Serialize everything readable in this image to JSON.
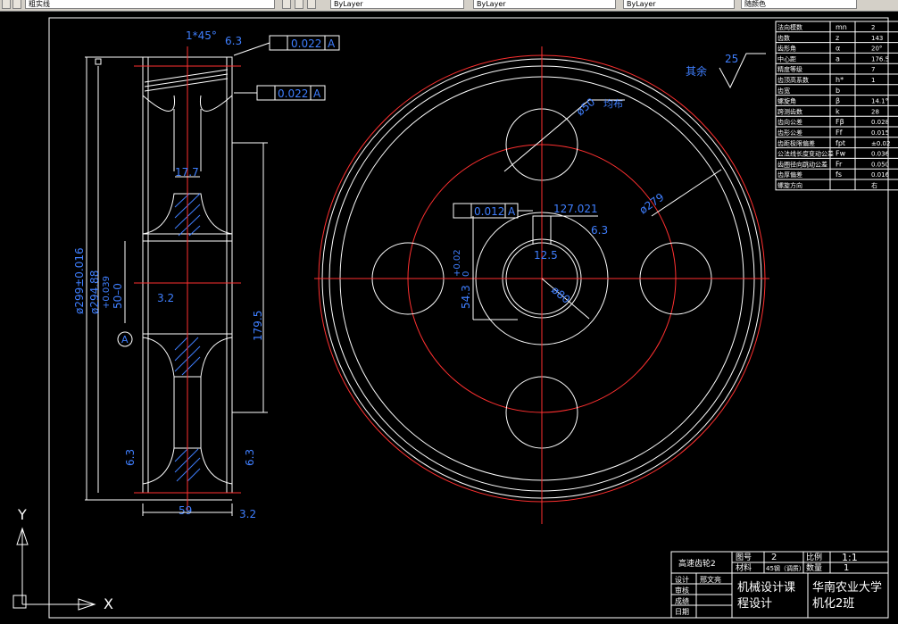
{
  "toolbar": {
    "layer_name": "粗实线",
    "color_combo": "ByLayer",
    "linetype_combo": "ByLayer",
    "lineweight_combo": "ByLayer",
    "plotstyle_combo": "随颜色"
  },
  "drawing": {
    "chamfer": "1*45°",
    "roughness_top": "6.3",
    "tol_runout_1": "0.022",
    "tol_runout_2": "0.022",
    "datum": "A",
    "dim_17_7": "17.7",
    "dim_dia_outer": "ø299±0.016",
    "dim_dia_root": "ø294.88",
    "dim_bore_tol": "+0.039",
    "dim_bore": "50–0",
    "roughness_3_2a": "3.2",
    "dim_179_5": "179.5",
    "roughness_6_3_left": "6.3",
    "roughness_6_3_right": "6.3",
    "dim_59": "59",
    "roughness_3_2b": "3.2",
    "hole_dia": "ø50",
    "hole_note": "均布",
    "dia_279": "ø279",
    "dia_80": "ø80",
    "sym_tol": "0.012",
    "keyway_depth": "127.021",
    "keyway_width": "12.5",
    "keyway_tol": "+0.02",
    "keyway_tol2": "0",
    "keyway_54": "54.3",
    "roughness_6_3_key": "6.3",
    "qiyu": "其余",
    "qiyu_val": "25",
    "ucs_y": "Y",
    "ucs_x": "X"
  },
  "param_table": [
    {
      "name": "法向模数",
      "sym": "mn",
      "val": "2"
    },
    {
      "name": "齿数",
      "sym": "z",
      "val": "143"
    },
    {
      "name": "齿形角",
      "sym": "α",
      "val": "20°"
    },
    {
      "name": "中心距",
      "sym": "a",
      "val": "176.5"
    },
    {
      "name": "精度等级",
      "sym": "",
      "val": "7"
    },
    {
      "name": "齿顶高系数",
      "sym": "h*",
      "val": "1"
    },
    {
      "name": "齿宽",
      "sym": "b",
      "val": ""
    },
    {
      "name": "螺旋角",
      "sym": "β",
      "val": "14.1°"
    },
    {
      "name": "跨测齿数",
      "sym": "k",
      "val": "28"
    },
    {
      "name": "齿向公差",
      "sym": "Fβ",
      "val": "0.028"
    },
    {
      "name": "齿形公差",
      "sym": "Ff",
      "val": "0.015"
    },
    {
      "name": "齿距极限偏差",
      "sym": "fpt",
      "val": "±0.02"
    },
    {
      "name": "公法线长度变动公差",
      "sym": "Fw",
      "val": "0.036"
    },
    {
      "name": "齿圈径向跳动公差",
      "sym": "Fr",
      "val": "0.050"
    },
    {
      "name": "齿厚偏差",
      "sym": "fs",
      "val": "0.016"
    },
    {
      "name": "螺旋方向",
      "sym": "",
      "val": "右"
    }
  ],
  "title_block": {
    "part_name": "高速齿轮2",
    "drawing_no_label": "图号",
    "drawing_no": "2",
    "scale_label": "比例",
    "scale": "1:1",
    "material_label": "材料",
    "material": "45钢（调质）",
    "qty_label": "数量",
    "qty": "1",
    "design_label": "设计",
    "designer": "邢文亮",
    "check_label": "审核",
    "grade_label": "成绩",
    "date_label": "日期",
    "course": "机械设计课",
    "course2": "程设计",
    "school": "华南农业大学",
    "class_name": "机化2班"
  }
}
